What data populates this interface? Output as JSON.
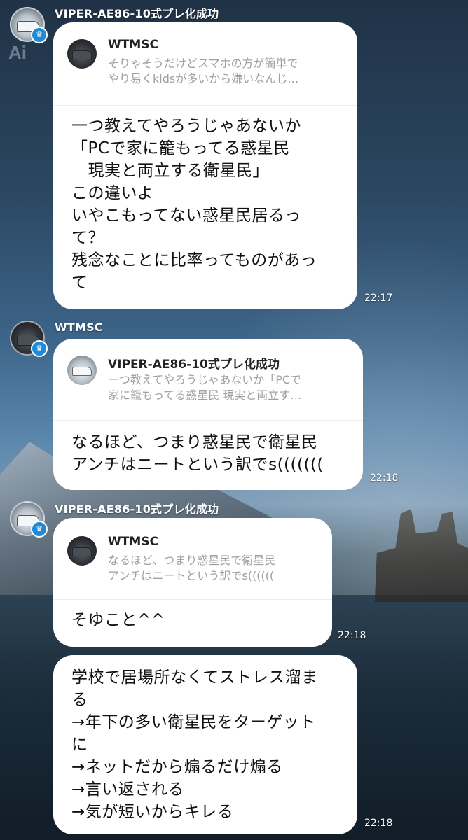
{
  "background": {
    "watermark": "Ai"
  },
  "messages": [
    {
      "sender": "VIPER-AE86-10式プレ化成功",
      "reply_to": {
        "name": "WTMSC",
        "preview": "そりゃそうだけどスマホの方が簡単で\nやり易くkidsが多いから嫌いなんじ…"
      },
      "text": "一つ教えてやろうじゃあないか\n「PCで家に籠もってる惑星民\n　現実と両立する衛星民」\nこの違いよ\nいやこもってない惑星民居るっ\nて？\n残念なことに比率ってものがあっ\nて",
      "time": "22:17"
    },
    {
      "sender": "WTMSC",
      "reply_to": {
        "name": "VIPER-AE86-10式プレ化成功",
        "preview": "一つ教えてやろうじゃあないか「PCで\n家に籠もってる惑星民 現実と両立す…"
      },
      "text": "なるほど、つまり惑星民で衛星民\nアンチはニートという訳でs(((((((",
      "time": "22:18"
    },
    {
      "sender": "VIPER-AE86-10式プレ化成功",
      "reply_to": {
        "name": "WTMSC",
        "preview": "なるほど、つまり惑星民で衛星民\nアンチはニートという訳でs(((((("
      },
      "text": "そゆこと^^",
      "time": "22:18"
    },
    {
      "text": "学校で居場所なくてストレス溜ま\nる\n→年下の多い衛星民をターゲット\nに\n→ネットだから煽るだけ煽る\n→言い返される\n→気が短いからキレる",
      "time": "22:18"
    }
  ]
}
